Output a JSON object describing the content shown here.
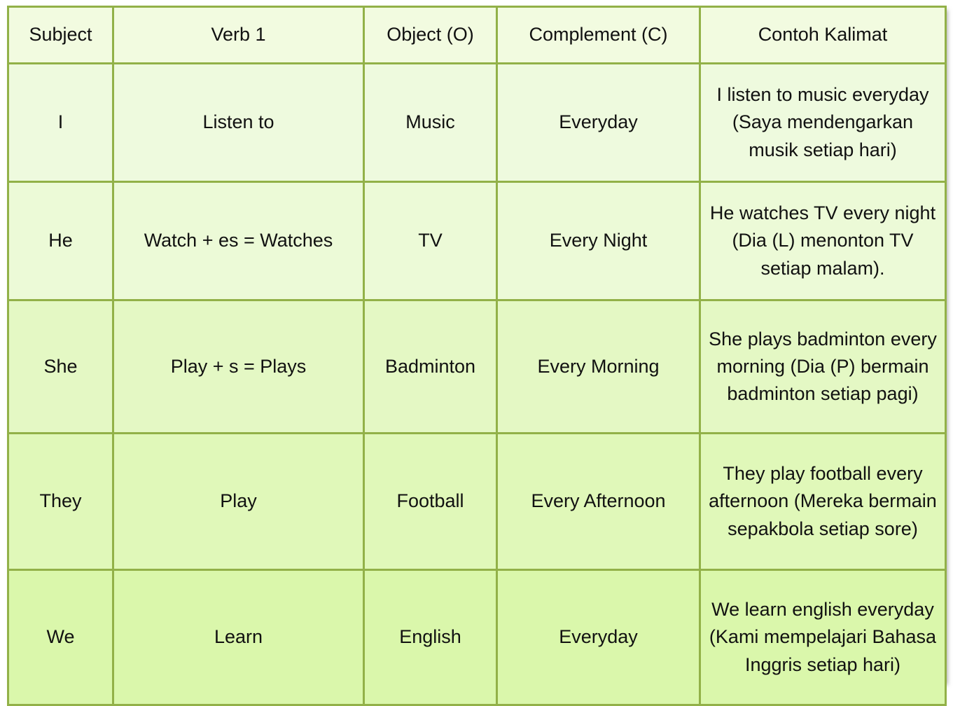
{
  "table": {
    "columns": [
      {
        "key": "subject",
        "label": "Subject"
      },
      {
        "key": "verb",
        "label": "Verb 1"
      },
      {
        "key": "object",
        "label": "Object (O)"
      },
      {
        "key": "complement",
        "label": "Complement (C)"
      },
      {
        "key": "example",
        "label": "Contoh Kalimat"
      }
    ],
    "rows": [
      {
        "subject": "I",
        "verb": "Listen to",
        "object": "Music",
        "complement": "Everyday",
        "example": "I listen to music everyday (Saya mendengarkan musik setiap hari)"
      },
      {
        "subject": "He",
        "verb": "Watch + es = Watches",
        "object": "TV",
        "complement": "Every Night",
        "example": "He watches TV every night (Dia (L) menonton TV setiap malam)."
      },
      {
        "subject": "She",
        "verb": "Play + s = Plays",
        "object": "Badminton",
        "complement": "Every Morning",
        "example": "She plays badminton every morning (Dia (P) bermain badminton setiap pagi)"
      },
      {
        "subject": "They",
        "verb": "Play",
        "object": "Football",
        "complement": "Every Afternoon",
        "example": "They play football every afternoon (Mereka bermain sepakbola setiap sore)"
      },
      {
        "subject": "We",
        "verb": "Learn",
        "object": "English",
        "complement": "Everyday",
        "example": "We learn english everyday (Kami mempelajari Bahasa Inggris setiap hari)"
      }
    ]
  },
  "colors": {
    "border": "#92b148",
    "header_background": "#f2fbe0",
    "row_1_background": "#eefade",
    "row_2_background": "#ecfad7",
    "row_3_background": "#e4f8c4",
    "row_4_background": "#e0f8b9",
    "row_5_background": "#daf7ab",
    "text": "#111111",
    "page_background": "#ffffff"
  }
}
